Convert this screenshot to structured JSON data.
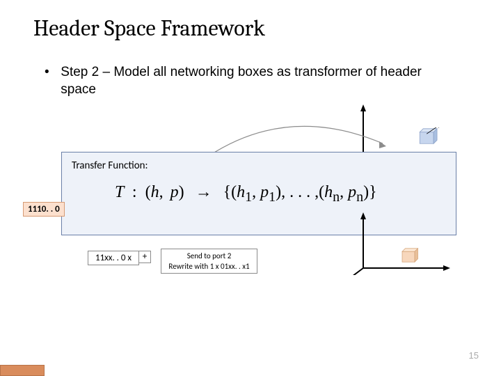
{
  "title": "Header Space Framework",
  "bullet": {
    "marker": "•",
    "text": "Step 2 – Model all networking boxes as transformer of header space"
  },
  "panel": {
    "label": "Transfer Function:",
    "formula": {
      "T": "T",
      "colon": ":",
      "lp": "(",
      "h": "h",
      "comma1": ",",
      "p": "p",
      "rp": ")",
      "arrow": "→",
      "lbrace": "{",
      "h1": "h",
      "sub1a": "1",
      "p1": "p",
      "sub1b": "1",
      "dots": ", . . . ,",
      "hn": "h",
      "subn1": "n",
      "pn": "p",
      "subn2": "n",
      "rbrace": "}"
    }
  },
  "labels": {
    "l1110": "1110. . 0",
    "l11xx": "11xx. . 0 x",
    "plus": "+",
    "action_line1": "Send to port 2",
    "action_line2": "Rewrite with 1 x 01xx. . x1"
  },
  "pagenum": "15"
}
